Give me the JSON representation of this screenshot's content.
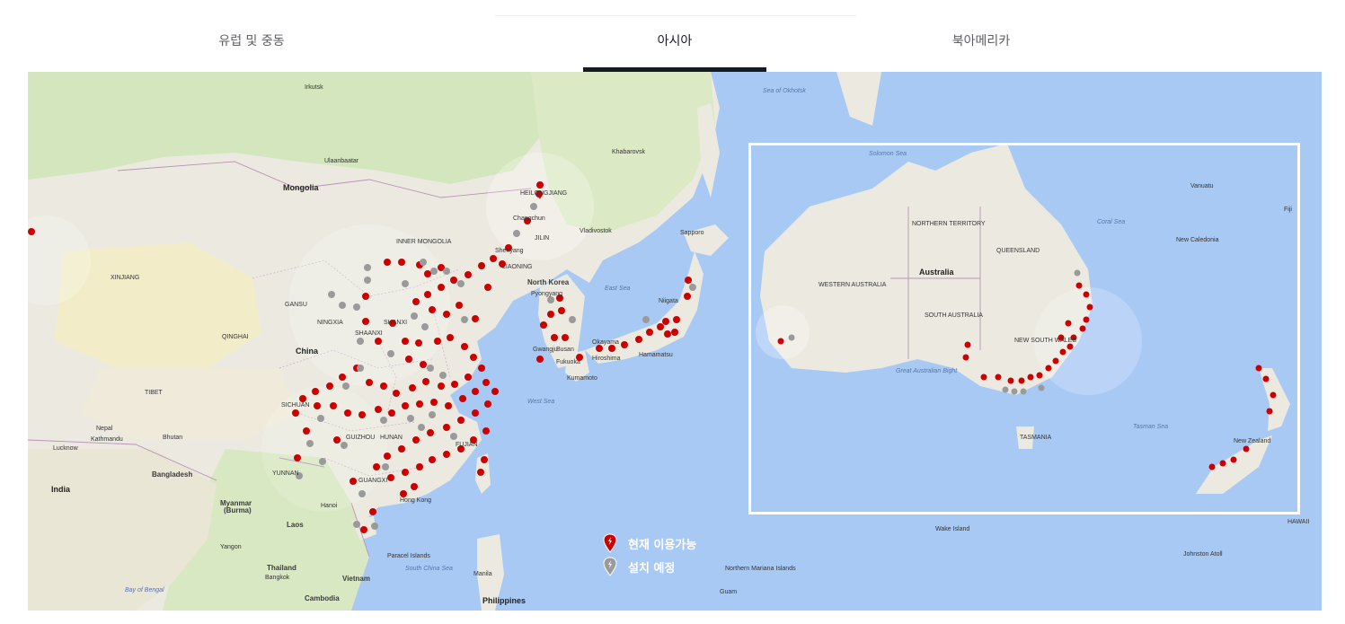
{
  "tabs": [
    {
      "label": "유럽 및 중동",
      "active": false
    },
    {
      "label": "아시아",
      "active": true
    },
    {
      "label": "북아메리카",
      "active": false
    }
  ],
  "legend": {
    "available": "현재 이용가능",
    "planned": "설치 예정"
  },
  "map": {
    "labels": {
      "mongolia": "Mongolia",
      "china": "China",
      "india": "India",
      "north_korea": "North Korea",
      "australia": "Australia",
      "hong_kong": "Hong Kong",
      "philippines": "Philippines",
      "east_sea": "East Sea",
      "west_sea": "West Sea",
      "ulaanbaatar": "Ulaanbaatar",
      "irkutsk": "Irkutsk",
      "khabarovsk": "Khabarovsk",
      "vladivostok": "Vladivostok",
      "sapporo": "Sapporo",
      "xinjiang": "XINJIANG",
      "qinghai": "QINGHAI",
      "tibet": "TIBET",
      "nepal": "Nepal",
      "bhutan": "Bhutan",
      "bangladesh": "Bangladesh",
      "myanmar": "Myanmar",
      "burma": "(Burma)",
      "laos": "Laos",
      "thailand": "Thailand",
      "cambodia": "Cambodia",
      "vietnam": "Vietnam",
      "bangkok": "Bangkok",
      "yangon": "Yangon",
      "hanoi": "Hanoi",
      "kathmandu": "Kathmandu",
      "lucknow": "Lucknow",
      "bay_of_bengal": "Bay of Bengal",
      "south_china_sea": "South China Sea",
      "paracel": "Paracel Islands",
      "manila": "Manila",
      "fukuoka": "Fukuoka",
      "hiroshima": "Hiroshima",
      "hamamatsu": "Hamamatsu",
      "okayama": "Okayama",
      "kumamoto": "Kumamoto",
      "busan": "Busan",
      "gwangju": "Gwangju",
      "pyongyang": "Pyongyang",
      "niigata": "Niigata",
      "shenyang": "Shenyang",
      "changchun": "Changchun",
      "jilin": "JILIN",
      "heilongjiang": "HEILONGJIANG",
      "liaoning": "LIAONING",
      "inner_mongolia": "INNER MONGOLIA",
      "gansu": "GANSU",
      "ningxia": "NINGXIA",
      "shanxi": "SHANXI",
      "shaanxi": "SHAANXI",
      "sichuan": "SICHUAN",
      "guizhou": "GUIZHOU",
      "yunnan": "YUNNAN",
      "guangxi": "GUANGXI",
      "hunan": "HUNAN",
      "fujian": "FUJIAN",
      "sea_of_okhotsk": "Sea of Okhotsk",
      "hawaii": "HAWAII",
      "wake_island": "Wake Island",
      "johnston_atoll": "Johnston Atoll",
      "northern_mariana": "Northern Mariana Islands",
      "guam": "Guam",
      "new_zealand": "New Zealand",
      "western_australia": "WESTERN AUSTRALIA",
      "northern_territory": "NORTHERN TERRITORY",
      "queensland": "QUEENSLAND",
      "south_australia": "SOUTH AUSTRALIA",
      "new_south_wales": "NEW SOUTH WALES",
      "tasmania": "TASMANIA",
      "coral_sea": "Coral Sea",
      "tasman_sea": "Tasman Sea",
      "great_australian_bight": "Great Australian Bight",
      "solomon_sea": "Solomon Sea",
      "fiji": "Fiji",
      "new_caledonia": "New Caledonia",
      "vanuatu": "Vanuatu"
    },
    "colors": {
      "water": "#a9c9f5",
      "land": "#eceae0",
      "green": "#cfe3b3",
      "desert": "#f3eec5",
      "available_pin": "#cc0000",
      "planned_pin": "#9a9a9a"
    }
  }
}
